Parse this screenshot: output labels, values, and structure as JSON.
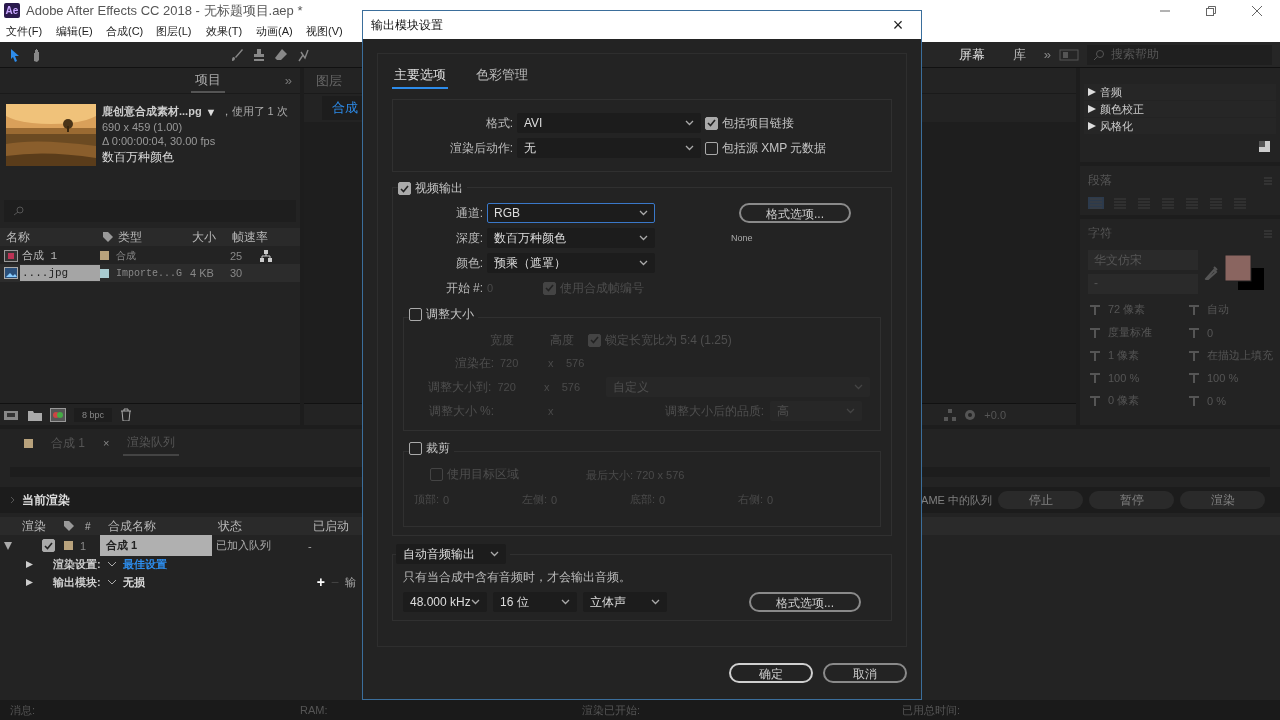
{
  "app": {
    "logo": "Ae",
    "title": "Adobe After Effects CC 2018 - 无标题项目.aep *"
  },
  "menu": [
    "文件(F)",
    "编辑(E)",
    "合成(C)",
    "图层(L)",
    "效果(T)",
    "动画(A)",
    "视图(V)"
  ],
  "toolbar": {
    "workspaces": [
      {
        "label": "屏幕",
        "selected": true
      },
      {
        "label": "库",
        "selected": false
      }
    ],
    "overflow": "»",
    "search": {
      "placeholder": "搜索帮助"
    }
  },
  "project": {
    "tab": "项目",
    "overflow": "»",
    "preview": {
      "name": "鹿创意合成素材...pg",
      "caret": "▼",
      "usage": "，使用了 1 次",
      "size": "690 x 459 (1.00)",
      "duration": "Δ 0:00:00:04, 30.00 fps",
      "colors": "数百万种颜色"
    },
    "columns": [
      "名称",
      "类型",
      "大小",
      "帧速率"
    ],
    "items": [
      {
        "kind": "comp",
        "name": "合成 1",
        "color": "#b8a27c",
        "type": "合成",
        "fps": "25",
        "selected": false
      },
      {
        "kind": "footage",
        "name": "....jpg",
        "color": "#a9cbd0",
        "type": "Importe...G",
        "size": "4 KB",
        "fps": "30",
        "selected": true
      }
    ],
    "bpc": "8 bpc"
  },
  "viewer": {
    "tabs": [
      {
        "label": "图层",
        "selected": false
      },
      {
        "label": "合成",
        "selected": true
      }
    ],
    "exposure": "+0.0"
  },
  "effects": [
    "音频",
    "颜色校正",
    "风格化"
  ],
  "paragraph": {
    "title": "段落"
  },
  "character": {
    "title": "字符",
    "font": "华文仿宋",
    "style": "-",
    "size": "72 像素",
    "leading": "自动",
    "kerning": "度量标准",
    "tracking": "0",
    "stroke": "1 像素",
    "stroke_mode": "在描边上填充",
    "vscale": "100 %",
    "hscale": "100 %",
    "baseline": "0 像素",
    "tsume": "0 %"
  },
  "queue": {
    "tabs": [
      {
        "label": "合成 1",
        "selected": false
      },
      {
        "label": "渲染队列",
        "selected": true
      }
    ],
    "close": "×",
    "progress": {
      "level": 0
    },
    "current": "当前渲染",
    "buttons": [
      "AME 中的队列",
      "停止",
      "暂停",
      "渲染"
    ],
    "columns": [
      "渲染",
      "#",
      "合成名称",
      "状态",
      "已启动"
    ],
    "rows": [
      {
        "checked": true,
        "number": "1",
        "name": "合成 1",
        "status": "已加入队列",
        "started": "-",
        "expanded": true,
        "settings": [
          {
            "kind": "link",
            "label": "渲染设置:",
            "value": "最佳设置"
          },
          {
            "kind": "text",
            "label": "输出模块:",
            "value": "无损"
          }
        ],
        "plus": "+",
        "minus": "−",
        "output_to": "输"
      }
    ]
  },
  "status": {
    "message": "消息:",
    "ram": "RAM:",
    "started": "渲染已开始:",
    "elapsed": "已用总时间:"
  },
  "dialog": {
    "title": "输出模块设置",
    "close": "×",
    "tabs": [
      {
        "label": "主要选项",
        "selected": true
      },
      {
        "label": "色彩管理",
        "selected": false
      }
    ],
    "format": {
      "label": "格式:",
      "value": "AVI"
    },
    "post_render": {
      "label": "渲染后动作:",
      "value": "无"
    },
    "options": [
      {
        "label": "包括项目链接",
        "checked": true
      },
      {
        "label": "包括源 XMP 元数据",
        "checked": false
      }
    ],
    "video": {
      "label": "视频输出",
      "checked": true,
      "fields": [
        {
          "label": "通道:",
          "value": "RGB",
          "focused": true
        },
        {
          "label": "深度:",
          "value": "数百万种颜色",
          "focused": false
        },
        {
          "label": "颜色:",
          "value": "预乘（遮罩）",
          "focused": false
        }
      ],
      "start_label": "开始 #:",
      "start_value": "0",
      "use_comp_frame": {
        "label": "使用合成帧编号",
        "checked": true
      },
      "format_button": "格式选项...",
      "codec": "None"
    },
    "resize": {
      "label": "调整大小",
      "checked": false,
      "width_head": "宽度",
      "height_head": "高度",
      "lock": {
        "label": "锁定长宽比为 5:4 (1.25)",
        "checked": true
      },
      "render_label": "渲染在:",
      "render_w": "720",
      "render_x": "x",
      "render_h": "576",
      "to_label": "调整大小到:",
      "to_w": "720",
      "to_x": "x",
      "to_h": "576",
      "preset": "自定义",
      "pct_label": "调整大小 %:",
      "pct_x": "x",
      "quality_label": "调整大小后的品质:",
      "quality": "高"
    },
    "crop": {
      "label": "裁剪",
      "checked": false,
      "use_roi": {
        "label": "使用目标区域",
        "checked": false
      },
      "final": "最后大小: 720 x 576",
      "sides": [
        {
          "label": "顶部:",
          "value": "0"
        },
        {
          "label": "左侧:",
          "value": "0"
        },
        {
          "label": "底部:",
          "value": "0"
        },
        {
          "label": "右侧:",
          "value": "0"
        }
      ]
    },
    "audio": {
      "mode": "自动音频输出",
      "note": "只有当合成中含有音频时，才会输出音频。",
      "rate": "48.000 kHz",
      "depth": "16 位",
      "channels": "立体声",
      "format_button": "格式选项..."
    },
    "buttons": [
      {
        "label": "确定",
        "primary": true
      },
      {
        "label": "取消",
        "primary": false
      }
    ]
  }
}
